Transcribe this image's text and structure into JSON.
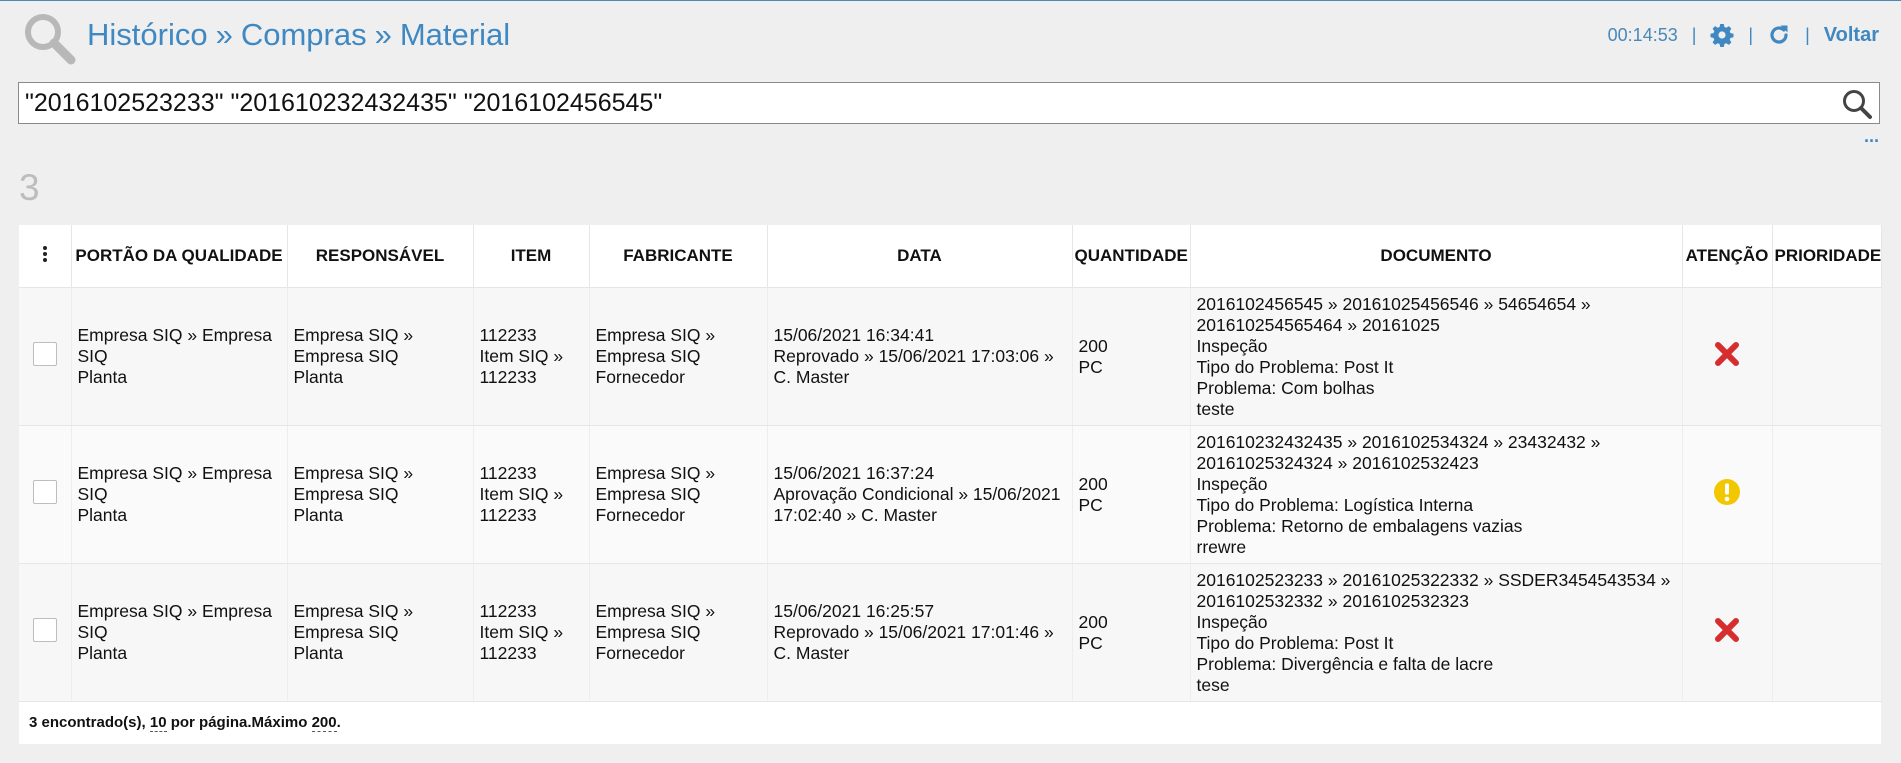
{
  "header": {
    "breadcrumb": [
      "Histórico",
      "Compras",
      "Material"
    ],
    "separator": "»",
    "timer": "00:14:53",
    "pipe": "|",
    "back_label": "Voltar"
  },
  "search": {
    "value": "\"2016102523233\" \"201610232432435\" \"2016102456545\""
  },
  "more_dots": "···",
  "result_count": "3",
  "table": {
    "columns": [
      "PORTÃO DA QUALIDADE",
      "RESPONSÁVEL",
      "ITEM",
      "FABRICANTE",
      "DATA",
      "QUANTIDADE",
      "DOCUMENTO",
      "ATENÇÃO",
      "PRIORIDADE"
    ],
    "rows": [
      {
        "portao": [
          "Empresa SIQ » Empresa",
          "SIQ",
          "Planta"
        ],
        "responsavel": [
          "Empresa SIQ »",
          "Empresa SIQ",
          "Planta"
        ],
        "item": [
          "112233",
          "Item SIQ »",
          "112233"
        ],
        "fabricante": [
          "Empresa SIQ »",
          "Empresa SIQ",
          "Fornecedor"
        ],
        "data": [
          "15/06/2021 16:34:41",
          "Reprovado » 15/06/2021 17:03:06 »",
          "C. Master"
        ],
        "quantidade": [
          "200",
          "PC"
        ],
        "documento": [
          "2016102456545 » 20161025456546 » 54654654 »",
          "201610254565464 » 20161025",
          "Inspeção",
          "Tipo do Problema: Post It",
          "Problema: Com bolhas",
          "teste"
        ],
        "atencao": "x-icon",
        "prioridade": ""
      },
      {
        "portao": [
          "Empresa SIQ » Empresa",
          "SIQ",
          "Planta"
        ],
        "responsavel": [
          "Empresa SIQ »",
          "Empresa SIQ",
          "Planta"
        ],
        "item": [
          "112233",
          "Item SIQ »",
          "112233"
        ],
        "fabricante": [
          "Empresa SIQ »",
          "Empresa SIQ",
          "Fornecedor"
        ],
        "data": [
          "15/06/2021 16:37:24",
          "Aprovação Condicional » 15/06/2021",
          "17:02:40 » C. Master"
        ],
        "quantidade": [
          "200",
          "PC"
        ],
        "documento": [
          "201610232432435 » 2016102534324 » 23432432 »",
          "20161025324324 » 2016102532423",
          "Inspeção",
          "Tipo do Problema: Logística Interna",
          "Problema: Retorno de embalagens vazias",
          "rrewre"
        ],
        "atencao": "warning-icon",
        "prioridade": ""
      },
      {
        "portao": [
          "Empresa SIQ » Empresa",
          "SIQ",
          "Planta"
        ],
        "responsavel": [
          "Empresa SIQ »",
          "Empresa SIQ",
          "Planta"
        ],
        "item": [
          "112233",
          "Item SIQ »",
          "112233"
        ],
        "fabricante": [
          "Empresa SIQ »",
          "Empresa SIQ",
          "Fornecedor"
        ],
        "data": [
          "15/06/2021 16:25:57",
          "Reprovado » 15/06/2021 17:01:46 »",
          "C. Master"
        ],
        "quantidade": [
          "200",
          "PC"
        ],
        "documento": [
          "2016102523233 » 20161025322332 » SSDER3454543534 »",
          "2016102532332 » 2016102532323",
          "Inspeção",
          "Tipo do Problema: Post It",
          "Problema: Divergência e falta de lacre",
          "tese"
        ],
        "atencao": "x-icon",
        "prioridade": ""
      }
    ]
  },
  "footer": {
    "found": "3 encontrado(s), ",
    "per_page": "10",
    "per_page_suffix": " por página.Máximo ",
    "max": "200",
    "end": "."
  },
  "colors": {
    "brand": "#3f88c2",
    "reject": "#d62e2e",
    "warning": "#f2c700"
  }
}
